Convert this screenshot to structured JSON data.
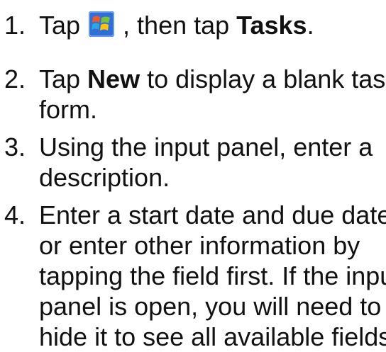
{
  "steps": [
    {
      "number": "1.",
      "pre": "Tap ",
      "icon": "windows-start-icon",
      "mid": " , then tap ",
      "bold": "Tasks",
      "post": "."
    },
    {
      "number": "2.",
      "pre": "Tap ",
      "bold": "New",
      "line1_post": " to display a blank task",
      "line2": "form."
    },
    {
      "number": "3.",
      "line1": "Using the input panel, enter a",
      "line2": "description."
    },
    {
      "number": "4.",
      "line1": "Enter a start date and due date,",
      "line2": "or enter other information by",
      "line3": "tapping the field first. If the input",
      "line4": "panel is open, you will need to",
      "line5": "hide it to see all available fields."
    }
  ]
}
